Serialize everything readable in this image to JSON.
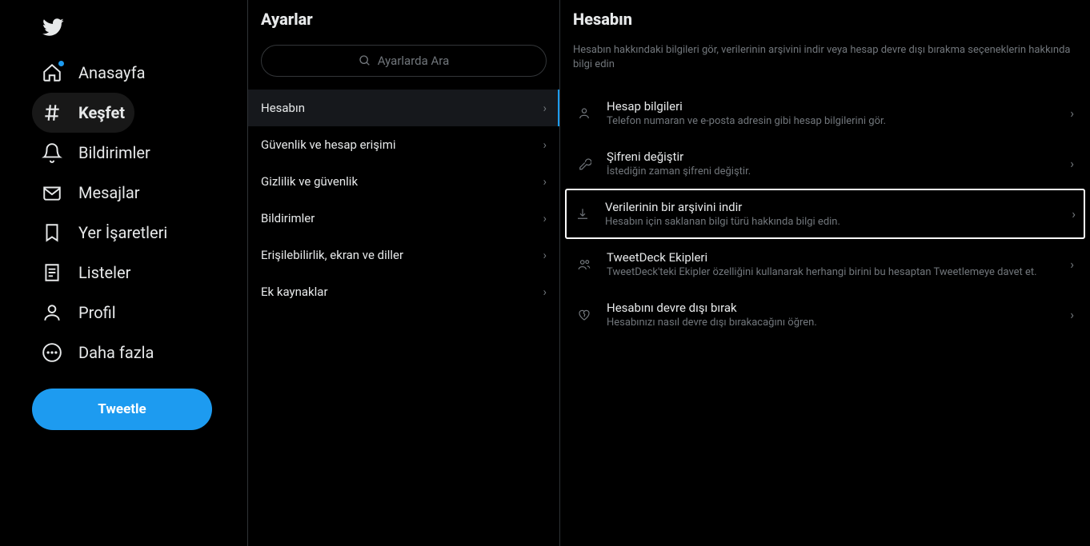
{
  "sidebar": {
    "items": [
      {
        "label": "Anasayfa",
        "icon": "home"
      },
      {
        "label": "Keşfet",
        "icon": "hash"
      },
      {
        "label": "Bildirimler",
        "icon": "bell"
      },
      {
        "label": "Mesajlar",
        "icon": "mail"
      },
      {
        "label": "Yer İşaretleri",
        "icon": "bookmark"
      },
      {
        "label": "Listeler",
        "icon": "list"
      },
      {
        "label": "Profil",
        "icon": "profile"
      },
      {
        "label": "Daha fazla",
        "icon": "more"
      }
    ],
    "tweet_label": "Tweetle"
  },
  "settings": {
    "title": "Ayarlar",
    "search_placeholder": "Ayarlarda Ara",
    "items": [
      {
        "label": "Hesabın"
      },
      {
        "label": "Güvenlik ve hesap erişimi"
      },
      {
        "label": "Gizlilik ve güvenlik"
      },
      {
        "label": "Bildirimler"
      },
      {
        "label": "Erişilebilirlik, ekran ve diller"
      },
      {
        "label": "Ek kaynaklar"
      }
    ]
  },
  "detail": {
    "title": "Hesabın",
    "description": "Hesabın hakkındaki bilgileri gör, verilerinin arşivini indir veya hesap devre dışı bırakma seçeneklerin hakkında bilgi edin",
    "items": [
      {
        "title": "Hesap bilgileri",
        "sub": "Telefon numaran ve e-posta adresin gibi hesap bilgilerini gör."
      },
      {
        "title": "Şifreni değiştir",
        "sub": "İstediğin zaman şifreni değiştir."
      },
      {
        "title": "Verilerinin bir arşivini indir",
        "sub": "Hesabın için saklanan bilgi türü hakkında bilgi edin."
      },
      {
        "title": "TweetDeck Ekipleri",
        "sub": "TweetDeck'teki Ekipler özelliğini kullanarak herhangi birini bu hesaptan Tweetlemeye davet et."
      },
      {
        "title": "Hesabını devre dışı bırak",
        "sub": "Hesabınızı nasıl devre dışı bırakacağını öğren."
      }
    ]
  }
}
